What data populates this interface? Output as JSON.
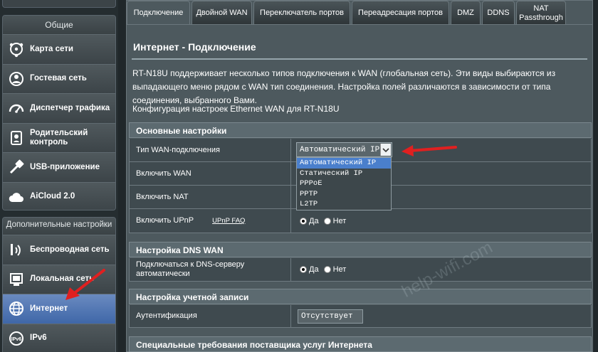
{
  "sidebar": {
    "general_header": "Общие",
    "general_items": [
      {
        "label": "Карта сети",
        "icon": "network-map-icon"
      },
      {
        "label": "Гостевая сеть",
        "icon": "guest-network-icon"
      },
      {
        "label": "Диспетчер трафика",
        "icon": "traffic-manager-icon"
      },
      {
        "label": "Родительский контроль",
        "icon": "parental-control-icon"
      },
      {
        "label": "USB-приложение",
        "icon": "usb-application-icon"
      },
      {
        "label": "AiCloud 2.0",
        "icon": "aicloud-icon"
      }
    ],
    "advanced_header": "Дополнительные настройки",
    "advanced_items": [
      {
        "label": "Беспроводная сеть",
        "icon": "wireless-icon"
      },
      {
        "label": "Локальная сеть",
        "icon": "lan-icon"
      },
      {
        "label": "Интернет",
        "icon": "internet-globe-icon",
        "active": true
      },
      {
        "label": "IPv6",
        "icon": "ipv6-icon"
      }
    ]
  },
  "tabs": [
    {
      "label": "Подключение",
      "active": true
    },
    {
      "label": "Двойной WAN"
    },
    {
      "label": "Переключатель портов"
    },
    {
      "label": "Переадресация портов"
    },
    {
      "label": "DMZ"
    },
    {
      "label": "DDNS"
    },
    {
      "label": "NAT Passthrough"
    }
  ],
  "main": {
    "title": "Интернет - Подключение",
    "description": "RT-N18U поддерживает несколько типов подключения к WAN (глобальная сеть). Эти виды выбираются из выпадающего меню рядом с WAN тип соединения. Настройка полей различаются в зависимости от типа соединения, выбранного Вами.",
    "config_line": "Конфигурация настроек Ethernet WAN для RT-N18U",
    "basic": {
      "header": "Основные настройки",
      "wan_type_label": "Тип WAN-подключения",
      "wan_type_value": "Автоматический IP",
      "wan_type_options": [
        "Автоматический IP",
        "Статический IP",
        "PPPoE",
        "PPTP",
        "L2TP"
      ],
      "enable_wan_label": "Включить WAN",
      "enable_nat_label": "Включить NAT",
      "enable_upnp_label": "Включить UPnP",
      "upnp_faq_link": "UPnP FAQ",
      "yes": "Да",
      "no": "Нет"
    },
    "dns": {
      "header": "Настройка DNS WAN",
      "auto_dns_label": "Подключаться к DNS-серверу автоматически",
      "yes": "Да",
      "no": "Нет"
    },
    "account": {
      "header": "Настройка учетной записи",
      "auth_label": "Аутентификация",
      "auth_value": "Отсутствует"
    },
    "isp": {
      "header": "Специальные требования поставщика услуг Интернета"
    }
  },
  "watermark": "help-wifi.com",
  "colors": {
    "accent": "#4a7fcc",
    "arrow": "#e02020",
    "panel": "#4d595e"
  }
}
